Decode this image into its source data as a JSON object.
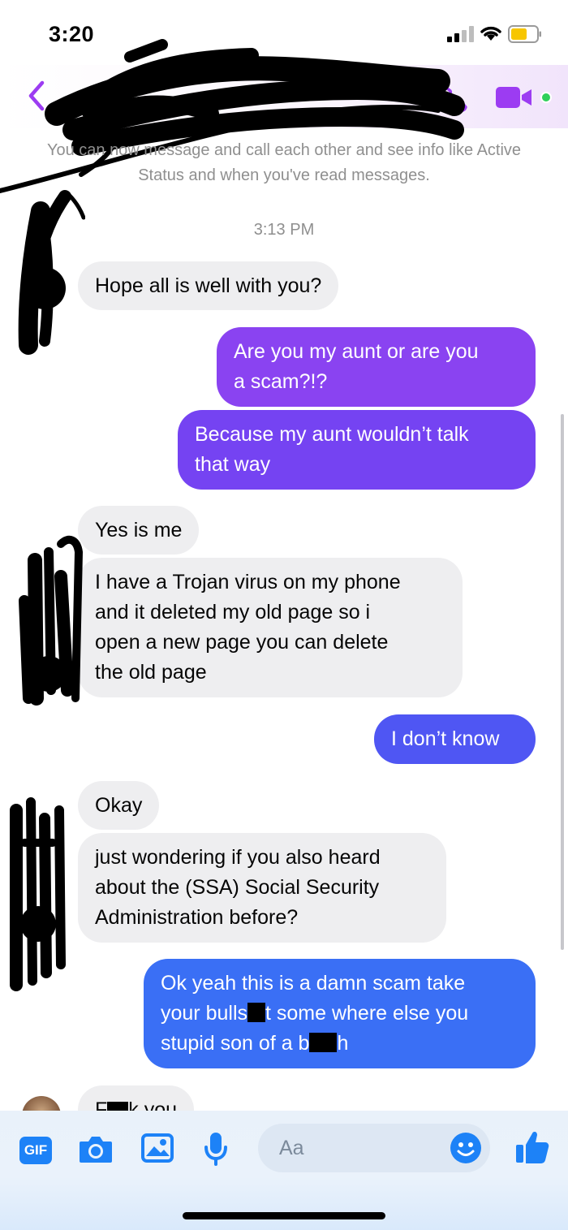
{
  "status_bar": {
    "time": "3:20"
  },
  "header": {
    "back_icon": "chevron-left-icon",
    "call_icon": "phone-icon",
    "video_icon": "video-camera-icon"
  },
  "notice": "You can now message and call each other and see info like Active Status and when you've read messages.",
  "timestamp": "3:13 PM",
  "messages": [
    {
      "from": "them",
      "text": "Hope all is well with you?"
    },
    {
      "from": "me",
      "line1": "Are you my aunt or are you",
      "line2": "a scam?!?"
    },
    {
      "from": "me",
      "line1": "Because my aunt wouldn’t talk",
      "line2": "that way"
    },
    {
      "from": "them",
      "text": "Yes is me"
    },
    {
      "from": "them",
      "line1": "I have a Trojan virus on my phone",
      "line2": "and it deleted my old page so i",
      "line3": "open a new page you can delete",
      "line4": "the old page"
    },
    {
      "from": "me",
      "text": "I don’t know"
    },
    {
      "from": "them",
      "text": "Okay"
    },
    {
      "from": "them",
      "line1": "just wondering if you also heard",
      "line2": "about the (SSA) Social Security",
      "line3": "Administration before?"
    },
    {
      "from": "me",
      "line1": "Ok yeah this is a damn scam take",
      "line2a": "your bulls",
      "line2b": "t some where else you",
      "line3a": "stupid son of a b",
      "line3b": "h"
    },
    {
      "from": "them",
      "text_a": "F",
      "text_b": "k you"
    }
  ],
  "composer": {
    "gif_label": "GIF",
    "input_placeholder": "Aa",
    "icons": [
      "gif-icon",
      "camera-icon",
      "image-icon",
      "microphone-icon",
      "emoji-icon",
      "thumbs-up-icon"
    ]
  },
  "colors": {
    "accent_purple": "#9c3cf2",
    "bubble_purple": "#7c3cf0",
    "bubble_blue": "#2f72f5",
    "incoming_bubble": "#eeeef0",
    "messenger_blue": "#1d82f7"
  }
}
